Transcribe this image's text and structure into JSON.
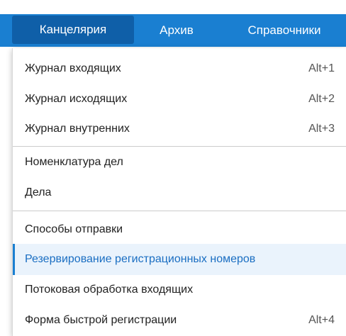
{
  "menubar": {
    "items": [
      {
        "label": "Канцелярия"
      },
      {
        "label": "Архив"
      },
      {
        "label": "Справочники"
      }
    ]
  },
  "dropdown": {
    "items": [
      {
        "label": "Журнал входящих",
        "shortcut": "Alt+1"
      },
      {
        "label": "Журнал исходящих",
        "shortcut": "Alt+2"
      },
      {
        "label": "Журнал внутренних",
        "shortcut": "Alt+3"
      },
      {
        "label": "Номенклатура дел",
        "shortcut": ""
      },
      {
        "label": "Дела",
        "shortcut": ""
      },
      {
        "label": "Способы отправки",
        "shortcut": ""
      },
      {
        "label": "Резервирование регистрационных номеров",
        "shortcut": ""
      },
      {
        "label": "Потоковая обработка входящих",
        "shortcut": ""
      },
      {
        "label": "Форма быстрой регистрации",
        "shortcut": "Alt+4"
      }
    ]
  },
  "colors": {
    "menubar_bg": "#1a7fd1",
    "active_tab_bg": "#0f5fa8",
    "highlight_bg": "#eaf3fc",
    "highlight_text": "#1a6ec2"
  }
}
